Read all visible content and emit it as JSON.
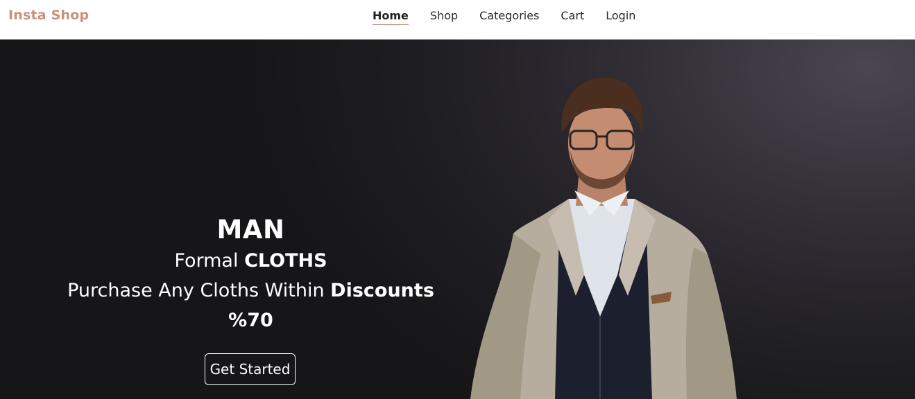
{
  "brand": {
    "name": "Insta Shop",
    "accent": "#c9917e"
  },
  "nav": {
    "items": [
      {
        "label": "Home",
        "active": true
      },
      {
        "label": "Shop",
        "active": false
      },
      {
        "label": "Categories",
        "active": false
      },
      {
        "label": "Cart",
        "active": false
      },
      {
        "label": "Login",
        "active": false
      }
    ]
  },
  "hero": {
    "title": "MAN",
    "line1_prefix": "Formal ",
    "line1_bold": "CLOTHS",
    "line2_prefix": "Purchase Any Cloths Within ",
    "line2_bold": "Discounts",
    "line3_bold": "%70",
    "cta_label": "Get Started",
    "image_subject": "man in beige blazer, navy cardigan and glasses"
  }
}
